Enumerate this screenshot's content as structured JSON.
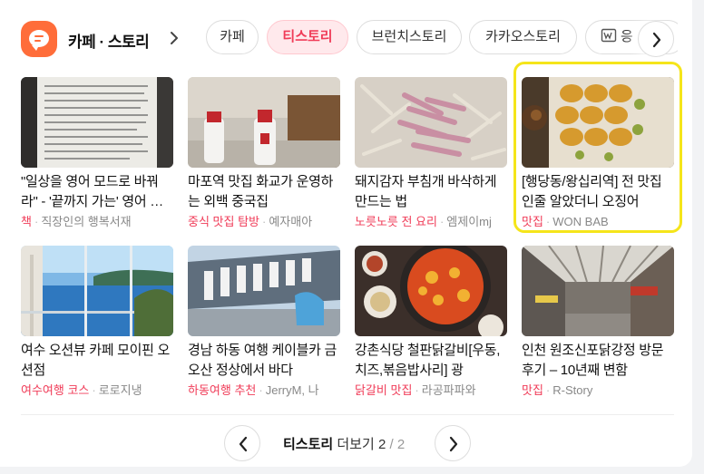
{
  "header": {
    "title": "카페 · 스토리"
  },
  "tabs": [
    {
      "label": "카페"
    },
    {
      "label": "티스토리"
    },
    {
      "label": "브런치스토리"
    },
    {
      "label": "카카오스토리"
    },
    {
      "label": "응"
    }
  ],
  "items": [
    {
      "title": "\"일상을 영어 모드로 바꿔라\" - '끝까지 가는' 영어 습관",
      "category": "책",
      "source": "직장인의 행복서재"
    },
    {
      "title": "마포역 맛집 화교가 운영하는 외백 중국집",
      "category": "중식 맛집 탐방",
      "source": "예자매아"
    },
    {
      "title": "돼지감자 부침개 바삭하게 만드는 법",
      "category": "노릇노릇 전 요리",
      "source": "엠제이mj"
    },
    {
      "title": "[행당동/왕십리역] 전 맛집인줄 알았더니 오징어",
      "category": "맛집",
      "source": "WON BAB"
    },
    {
      "title": "여수 오션뷰 카페 모이핀 오션점",
      "category": "여수여행 코스",
      "source": "로로지냉"
    },
    {
      "title": "경남 하동 여행 케이블카 금오산 정상에서 바다",
      "category": "하동여행 추천",
      "source": "JerryM, 나"
    },
    {
      "title": "강촌식당 철판닭갈비[우동,치즈,볶음밥사리] 광",
      "category": "닭갈비 맛집",
      "source": "라공파파와"
    },
    {
      "title": "인천 원조신포닭강정 방문 후기 – 10년째 변함",
      "category": "맛집",
      "source": "R-Story"
    }
  ],
  "pager": {
    "label": "티스토리",
    "more": "더보기",
    "current": "2",
    "separator": "/",
    "total": "2"
  },
  "colors": {
    "brand": "#ff6d3a",
    "accent": "#f03c58",
    "highlight": "#f5e51a"
  }
}
